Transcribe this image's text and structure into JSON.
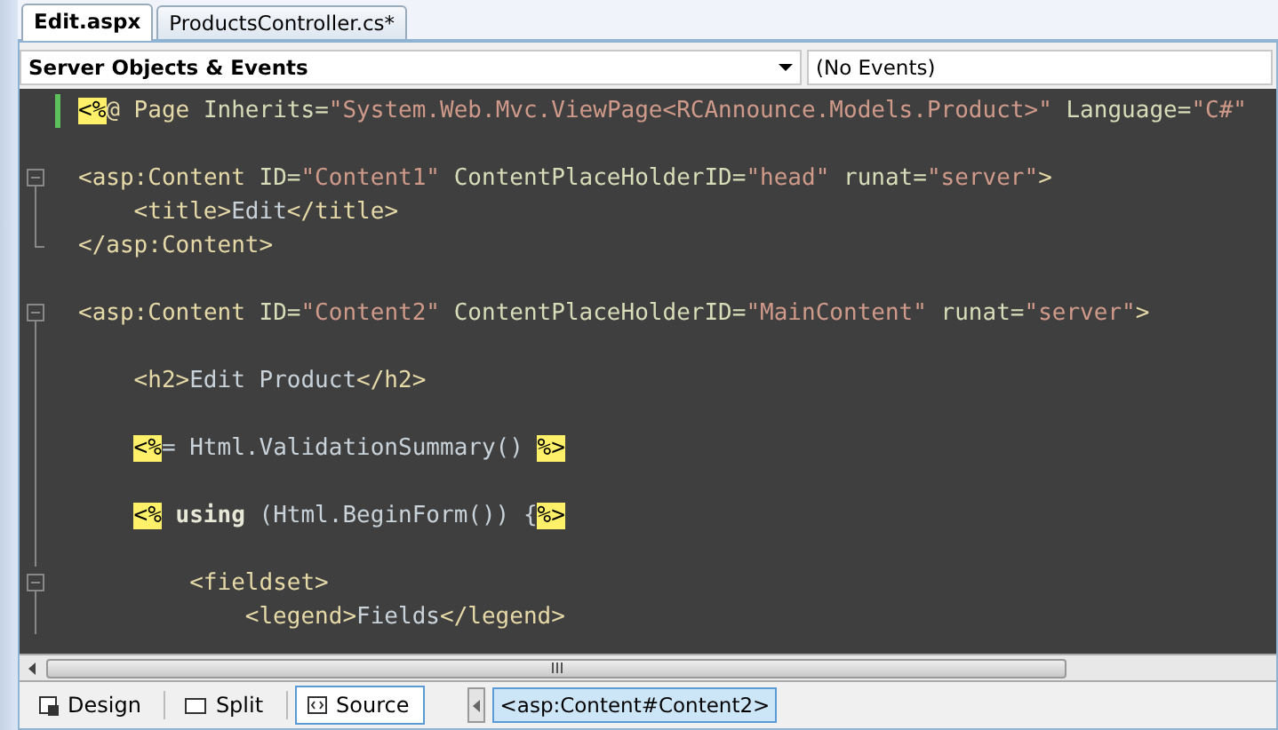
{
  "tabs": [
    {
      "label": "Edit.aspx",
      "selected": true
    },
    {
      "label": "ProductsController.cs*",
      "selected": false
    }
  ],
  "object_dropdown": {
    "value": "Server Objects & Events"
  },
  "event_dropdown": {
    "value": "(No Events)"
  },
  "code_lines": [
    {
      "kind": "plain",
      "changed": true,
      "tokens": [
        {
          "kind": "hl",
          "t": "<%"
        },
        {
          "kind": "tag",
          "t": "@ Page "
        },
        {
          "kind": "attr",
          "t": "Inherits="
        },
        {
          "kind": "value",
          "t": "\"System.Web.Mvc.ViewPage<RCAnnounce.Models.Product>\""
        },
        {
          "kind": "attr",
          "t": " Language="
        },
        {
          "kind": "value",
          "t": "\"C#\""
        }
      ]
    },
    {
      "kind": "plain",
      "changed": false
    },
    {
      "kind": "collapse",
      "changed": false,
      "tokens": [
        {
          "kind": "tag",
          "t": "<asp:Content "
        },
        {
          "kind": "attr",
          "t": "ID="
        },
        {
          "kind": "value",
          "t": "\"Content1\""
        },
        {
          "kind": "attr",
          "t": " ContentPlaceHolderID="
        },
        {
          "kind": "value",
          "t": "\"head\""
        },
        {
          "kind": "attr",
          "t": " runat="
        },
        {
          "kind": "value",
          "t": "\"server\""
        },
        {
          "kind": "tag",
          "t": ">"
        }
      ],
      "children": [
        {
          "kind": "line",
          "changed": false,
          "tokens": [
            {
              "kind": "tag",
              "t": "<title>"
            },
            {
              "kind": "text",
              "t": "Edit"
            },
            {
              "kind": "tag",
              "t": "</title>"
            }
          ]
        }
      ]
    },
    {
      "kind": "end",
      "changed": false,
      "tokens": [
        {
          "kind": "tag",
          "t": "</asp:Content>"
        }
      ]
    },
    {
      "kind": "plain",
      "changed": false
    },
    {
      "kind": "collapse",
      "changed": false,
      "tokens": [
        {
          "kind": "tag",
          "t": "<asp:Content "
        },
        {
          "kind": "attr",
          "t": "ID="
        },
        {
          "kind": "value",
          "t": "\"Content2\""
        },
        {
          "kind": "attr",
          "t": " ContentPlaceHolderID="
        },
        {
          "kind": "value",
          "t": "\"MainContent\""
        },
        {
          "kind": "attr",
          "t": " runat="
        },
        {
          "kind": "value",
          "t": "\"server\""
        },
        {
          "kind": "tag",
          "t": ">"
        }
      ],
      "children": [
        {
          "kind": "line",
          "changed": false
        },
        {
          "kind": "line",
          "changed": false,
          "tokens": [
            {
              "kind": "tag",
              "t": "<h2>"
            },
            {
              "kind": "text",
              "t": "Edit Product"
            },
            {
              "kind": "tag",
              "t": "</h2>"
            }
          ]
        },
        {
          "kind": "line",
          "changed": false
        },
        {
          "kind": "line",
          "changed": false,
          "tokens": [
            {
              "kind": "hl",
              "t": "<%"
            },
            {
              "kind": "text",
              "t": "= Html.ValidationSummary() "
            },
            {
              "kind": "hl",
              "t": "%>"
            }
          ]
        },
        {
          "kind": "line",
          "changed": false
        },
        {
          "kind": "line",
          "changed": false,
          "tokens": [
            {
              "kind": "hl",
              "t": "<%"
            },
            {
              "kind": "kw",
              "t": " using"
            },
            {
              "kind": "text",
              "t": " (Html.BeginForm()) {"
            },
            {
              "kind": "hl",
              "t": "%>"
            }
          ],
          "children": [
            {
              "kind": "line",
              "changed": false
            },
            {
              "kind": "collapse",
              "changed": false,
              "tokens": [
                {
                  "kind": "tag",
                  "t": "<fieldset>"
                }
              ],
              "children": [
                {
                  "kind": "line",
                  "changed": false,
                  "tokens": [
                    {
                      "kind": "tag",
                      "t": "<legend>"
                    },
                    {
                      "kind": "text",
                      "t": "Fields"
                    },
                    {
                      "kind": "tag",
                      "t": "</legend>"
                    }
                  ]
                }
              ]
            }
          ]
        }
      ]
    }
  ],
  "view_buttons": [
    {
      "label": "Design",
      "kind": "design",
      "selected": false
    },
    {
      "label": "Split",
      "kind": "split",
      "selected": false
    },
    {
      "label": "Source",
      "kind": "source",
      "selected": true
    }
  ],
  "breadcrumb": [
    {
      "label": "<asp:Content#Content2>",
      "selected": true
    }
  ]
}
